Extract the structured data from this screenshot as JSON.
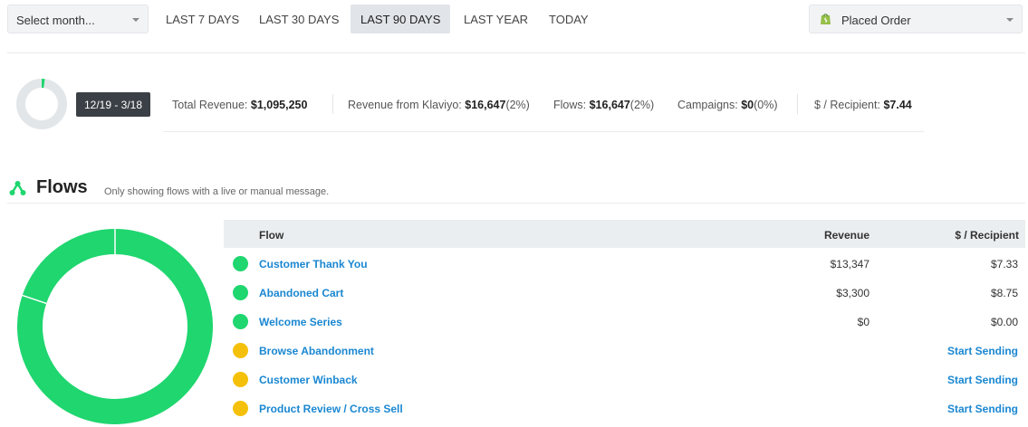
{
  "filters": {
    "month_placeholder": "Select month...",
    "ranges": [
      "LAST 7 DAYS",
      "LAST 30 DAYS",
      "LAST 90 DAYS",
      "LAST YEAR",
      "TODAY"
    ],
    "active_range": "LAST 90 DAYS",
    "metric": "Placed Order"
  },
  "summary": {
    "date_range": "12/19 - 3/18",
    "total_revenue_label": "Total Revenue:",
    "total_revenue": "$1,095,250",
    "klaviyo_label": "Revenue from Klaviyo:",
    "klaviyo_value": "$16,647",
    "klaviyo_pct": "(2%)",
    "flows_label": "Flows:",
    "flows_value": "$16,647",
    "flows_pct": "(2%)",
    "campaigns_label": "Campaigns:",
    "campaigns_value": "$0",
    "campaigns_pct": "(0%)",
    "per_recipient_label": "$ / Recipient:",
    "per_recipient_value": "$7.44",
    "klaviyo_share": 0.02
  },
  "flows_section": {
    "title": "Flows",
    "subtitle": "Only showing flows with a live or manual message."
  },
  "table": {
    "headers": {
      "flow": "Flow",
      "revenue": "Revenue",
      "per_recipient": "$ / Recipient"
    },
    "rows": [
      {
        "name": "Customer Thank You",
        "status": "live",
        "revenue": "$13,347",
        "per_recipient": "$7.33"
      },
      {
        "name": "Abandoned Cart",
        "status": "live",
        "revenue": "$3,300",
        "per_recipient": "$8.75"
      },
      {
        "name": "Welcome Series",
        "status": "live",
        "revenue": "$0",
        "per_recipient": "$0.00"
      },
      {
        "name": "Browse Abandonment",
        "status": "manual",
        "action": "Start Sending"
      },
      {
        "name": "Customer Winback",
        "status": "manual",
        "action": "Start Sending"
      },
      {
        "name": "Product Review / Cross Sell",
        "status": "manual",
        "action": "Start Sending"
      }
    ]
  },
  "donut": {
    "segments": [
      {
        "name": "Customer Thank You",
        "value": 13347
      },
      {
        "name": "Abandoned Cart",
        "value": 3300
      }
    ]
  },
  "colors": {
    "live": "#1fd66f",
    "manual": "#f5c00a",
    "link": "#1a87d1",
    "donut": "#1fd66f",
    "track": "#e3e6e9"
  }
}
